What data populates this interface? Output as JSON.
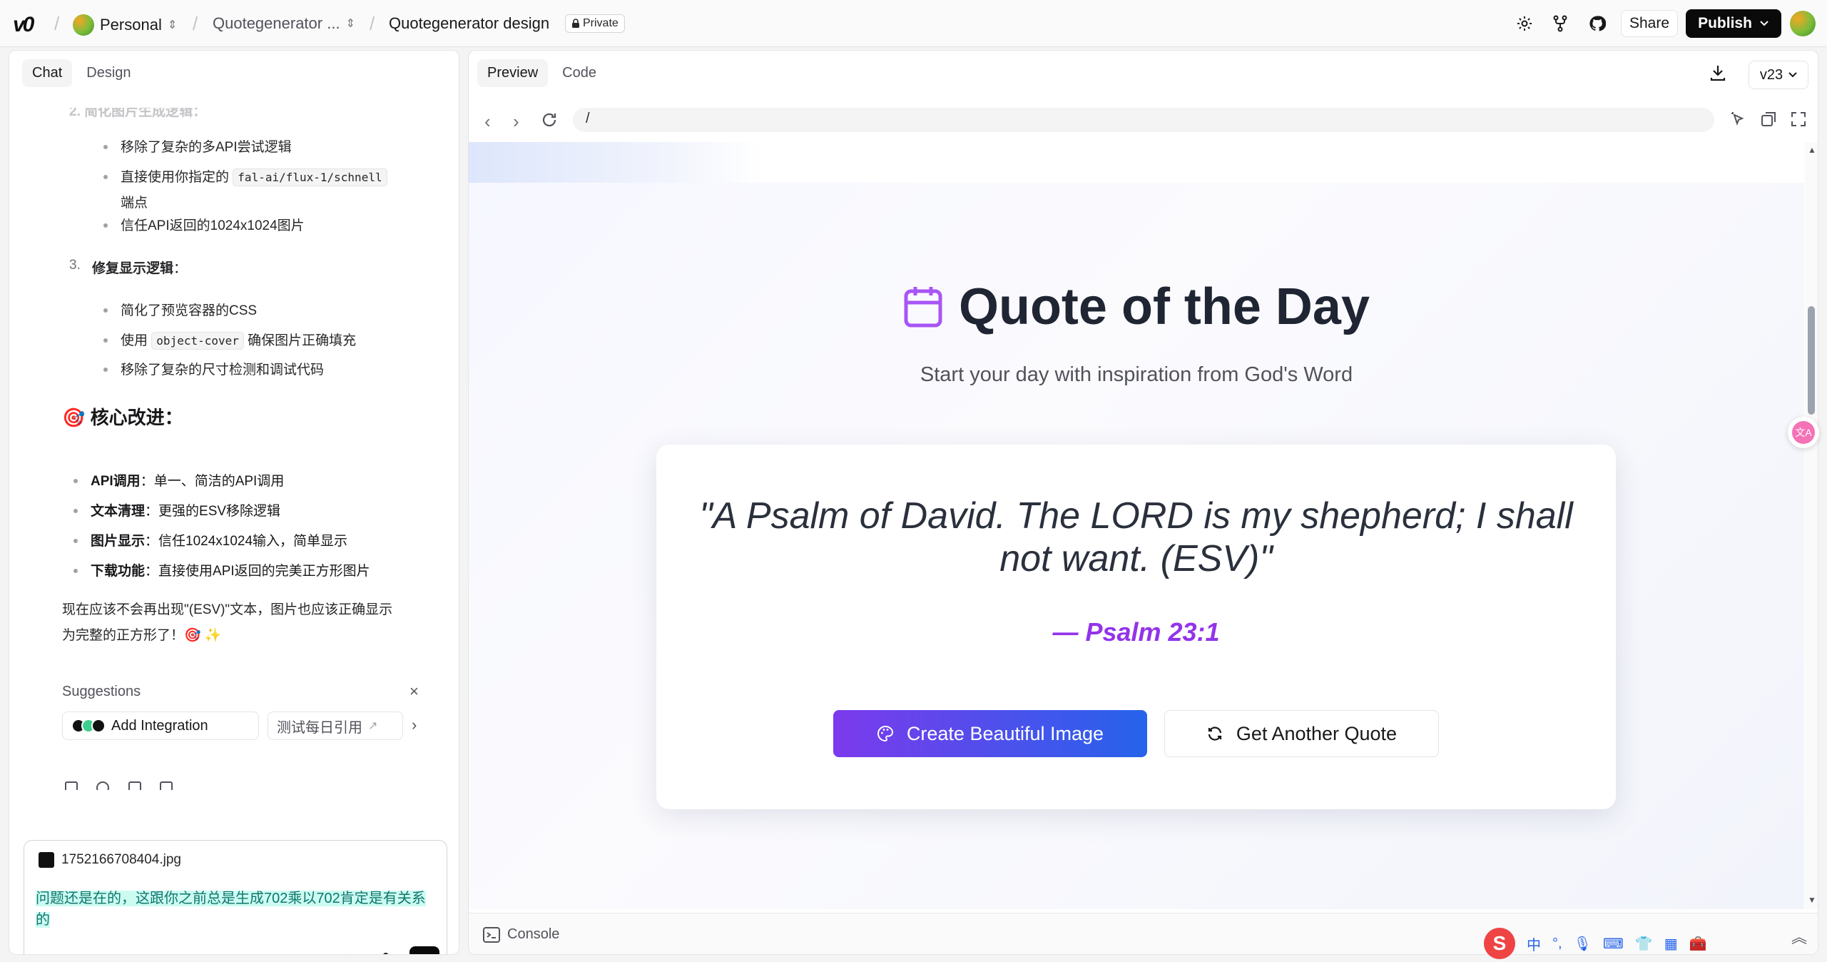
{
  "topbar": {
    "workspace": "Personal",
    "project": "Quotegenerator ...",
    "chat_title": "Quotegenerator design",
    "privacy": "Private",
    "share": "Share",
    "publish": "Publish"
  },
  "left_panel": {
    "tabs": [
      "Chat",
      "Design"
    ],
    "chat": {
      "partial_heading": "2.  简化图片生成逻辑：",
      "list1": [
        "移除了复杂的多API尝试逻辑",
        "直接使用你指定的",
        "端点",
        "信任API返回的1024x1024图片"
      ],
      "list1_code": "fal-ai/flux-1/schnell",
      "step3_num": "3.",
      "step3_title": "修复显示逻辑",
      "step3_colon": "：",
      "list2": [
        "简化了预览容器的CSS",
        "使用",
        "确保图片正确填充",
        "移除了复杂的尺寸检测和调试代码"
      ],
      "list2_code": "object-cover",
      "core_heading": "核心改进：",
      "core_items": [
        {
          "bold": "API调用",
          "text": "：单一、简洁的API调用"
        },
        {
          "bold": "文本清理",
          "text": "：更强的ESV移除逻辑"
        },
        {
          "bold": "图片显示",
          "text": "：信任1024x1024输入，简单显示"
        },
        {
          "bold": "下载功能",
          "text": "：直接使用API返回的完美正方形图片"
        }
      ],
      "conclusion_line1": "现在应该不会再出现\"(ESV)\"文本，图片也应该正确显示",
      "conclusion_line2": "为完整的正方形了！🎯 ✨"
    },
    "suggestions": {
      "title": "Suggestions",
      "chips": [
        "Add Integration",
        "测试每日引用"
      ]
    },
    "composer": {
      "attachment": "1752166708404.jpg",
      "text": "问题还是在的，这跟你之前总是生成702乘以702肯定是有关系的"
    }
  },
  "right_panel": {
    "tabs": [
      "Preview",
      "Code"
    ],
    "url": "/",
    "version": "v23",
    "console": "Console"
  },
  "app": {
    "title": "Quote of the Day",
    "subtitle": "Start your day with inspiration from God's Word",
    "quote": "\"A Psalm of David. The LORD is my shepherd; I shall not want. (ESV)\"",
    "reference": "— Psalm 23:1",
    "primary_button": "Create Beautiful Image",
    "secondary_button": "Get Another Quote"
  },
  "ime": {
    "lang": "中"
  },
  "colors": {
    "accent_purple": "#9333ea",
    "button_gradient_start": "#7c3aed",
    "button_gradient_end": "#2563eb",
    "publish_bg": "#0a0a0a"
  }
}
